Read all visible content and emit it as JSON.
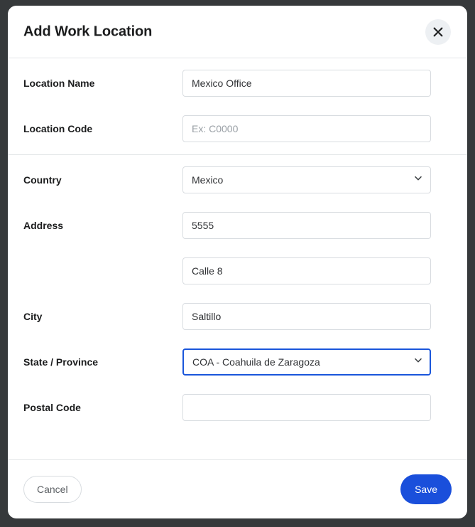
{
  "modal": {
    "title": "Add Work Location",
    "close_icon": "close-icon",
    "colors": {
      "accent_blue": "#1a4fdb",
      "focus_blue": "#1a56db",
      "required_red": "#f4364c",
      "border_gray": "#d8dce0",
      "backdrop": "#36393b",
      "close_bg": "#edf0f3"
    }
  },
  "sections": [
    {
      "fields": [
        {
          "label": "Location Name",
          "required": true,
          "required_marker": "*",
          "type": "text",
          "value": "Mexico Office",
          "placeholder": ""
        },
        {
          "label": "Location Code",
          "required": false,
          "required_marker": "",
          "type": "text",
          "value": "",
          "placeholder": "Ex: C0000"
        }
      ]
    },
    {
      "fields": [
        {
          "label": "Country",
          "required": true,
          "required_marker": "*",
          "type": "select",
          "value": "Mexico",
          "placeholder": "",
          "focused": false
        },
        {
          "label": "Address",
          "required": false,
          "required_marker": "",
          "type": "text",
          "value": "5555",
          "placeholder": ""
        },
        {
          "label": "",
          "required": false,
          "required_marker": "",
          "type": "text",
          "value": "Calle 8",
          "placeholder": ""
        },
        {
          "label": "City",
          "required": false,
          "required_marker": "",
          "type": "text",
          "value": "Saltillo",
          "placeholder": ""
        },
        {
          "label": "State / Province",
          "required": true,
          "required_marker": "*",
          "type": "select",
          "value": "COA - Coahuila de Zaragoza",
          "placeholder": "",
          "focused": true
        },
        {
          "label": "Postal Code",
          "required": false,
          "required_marker": "",
          "type": "text",
          "value": "",
          "placeholder": ""
        }
      ]
    }
  ],
  "footer": {
    "cancel_label": "Cancel",
    "save_label": "Save"
  }
}
